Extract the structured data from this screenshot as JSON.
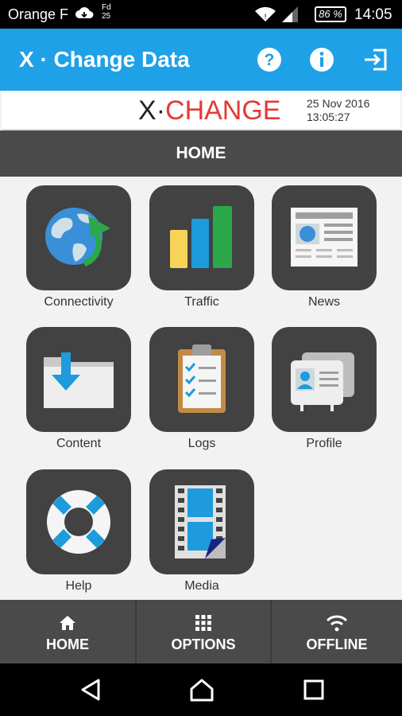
{
  "status_bar": {
    "carrier": "Orange F",
    "notification_text": "Fd 25",
    "battery": "86 %",
    "time": "14:05"
  },
  "app_bar": {
    "title": "X · Change Data"
  },
  "brand": {
    "logo_x": "X",
    "logo_dot": "·",
    "logo_change": "CHANGE",
    "date": "25 Nov 2016",
    "time": "13:05:27"
  },
  "section": {
    "title": "HOME"
  },
  "tiles": [
    {
      "label": "Connectivity",
      "icon": "globe-icon"
    },
    {
      "label": "Traffic",
      "icon": "bar-chart-icon"
    },
    {
      "label": "News",
      "icon": "newspaper-icon"
    },
    {
      "label": "Content",
      "icon": "folder-download-icon"
    },
    {
      "label": "Logs",
      "icon": "clipboard-icon"
    },
    {
      "label": "Profile",
      "icon": "id-card-icon"
    },
    {
      "label": "Help",
      "icon": "lifebuoy-icon"
    },
    {
      "label": "Media",
      "icon": "film-icon"
    }
  ],
  "bottom_nav": {
    "home": "HOME",
    "options": "OPTIONS",
    "offline": "OFFLINE"
  },
  "colors": {
    "accent": "#1ea1e6",
    "dark": "#4a4a4a",
    "tile": "#424242",
    "brand_red": "#e53935"
  }
}
